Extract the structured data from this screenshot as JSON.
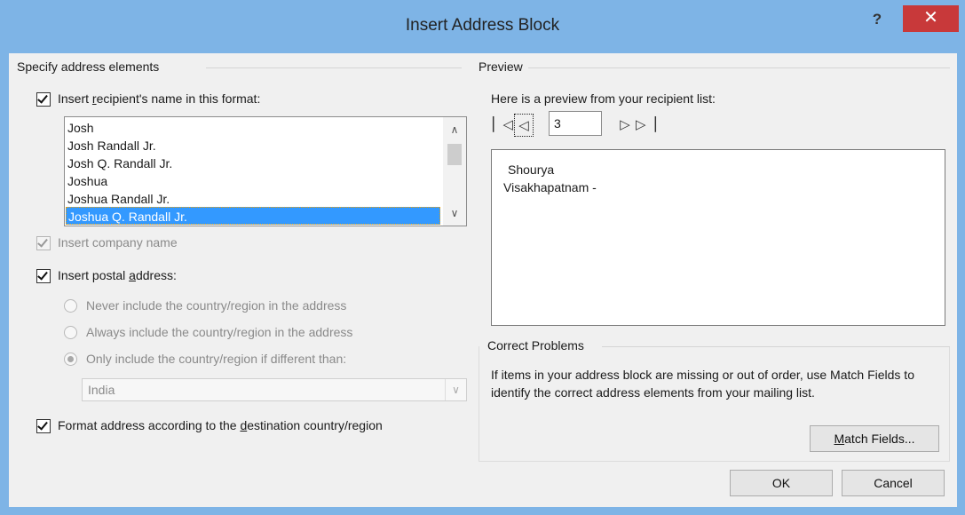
{
  "window": {
    "title": "Insert Address Block",
    "help_label": "?",
    "close_label": "✕"
  },
  "left": {
    "group_title": "Specify address elements",
    "insert_name": {
      "label_pre": "Insert ",
      "label_accel": "r",
      "label_post": "ecipient's name in this format:",
      "checked": true
    },
    "name_formats": [
      "Josh",
      "Josh Randall Jr.",
      "Josh Q. Randall Jr.",
      "Joshua",
      "Joshua Randall Jr.",
      "Joshua Q. Randall Jr."
    ],
    "selected_format": "Joshua Q. Randall Jr.",
    "insert_company": {
      "label": "Insert company name",
      "checked": true,
      "disabled": true
    },
    "insert_postal": {
      "label_pre": "Insert postal ",
      "label_accel": "a",
      "label_post": "ddress:",
      "checked": true
    },
    "country_options": [
      "Never include the country/region in the address",
      "Always include the country/region in the address",
      "Only include the country/region if different than:"
    ],
    "country_selected_index": 2,
    "country_value": "India",
    "format_address": {
      "label_pre": "Format address according to the ",
      "label_accel": "d",
      "label_post": "estination country/region",
      "checked": true
    }
  },
  "right": {
    "preview_title": "Preview",
    "preview_intro": "Here is a preview from your recipient list:",
    "record_number": "3",
    "preview_lines": [
      "Shourya",
      "Visakhapatnam -"
    ],
    "problems_title": "Correct Problems",
    "problems_text": "If items in your address block are missing or out of order, use Match Fields to identify the correct address elements from your mailing list.",
    "match_fields": {
      "accel": "M",
      "rest": "atch Fields..."
    }
  },
  "footer": {
    "ok_label": "OK",
    "cancel_label": "Cancel"
  },
  "icons": {
    "first_record": "first-record-icon",
    "previous_record": "previous-record-icon",
    "next_record": "next-record-icon",
    "last_record": "last-record-icon"
  }
}
